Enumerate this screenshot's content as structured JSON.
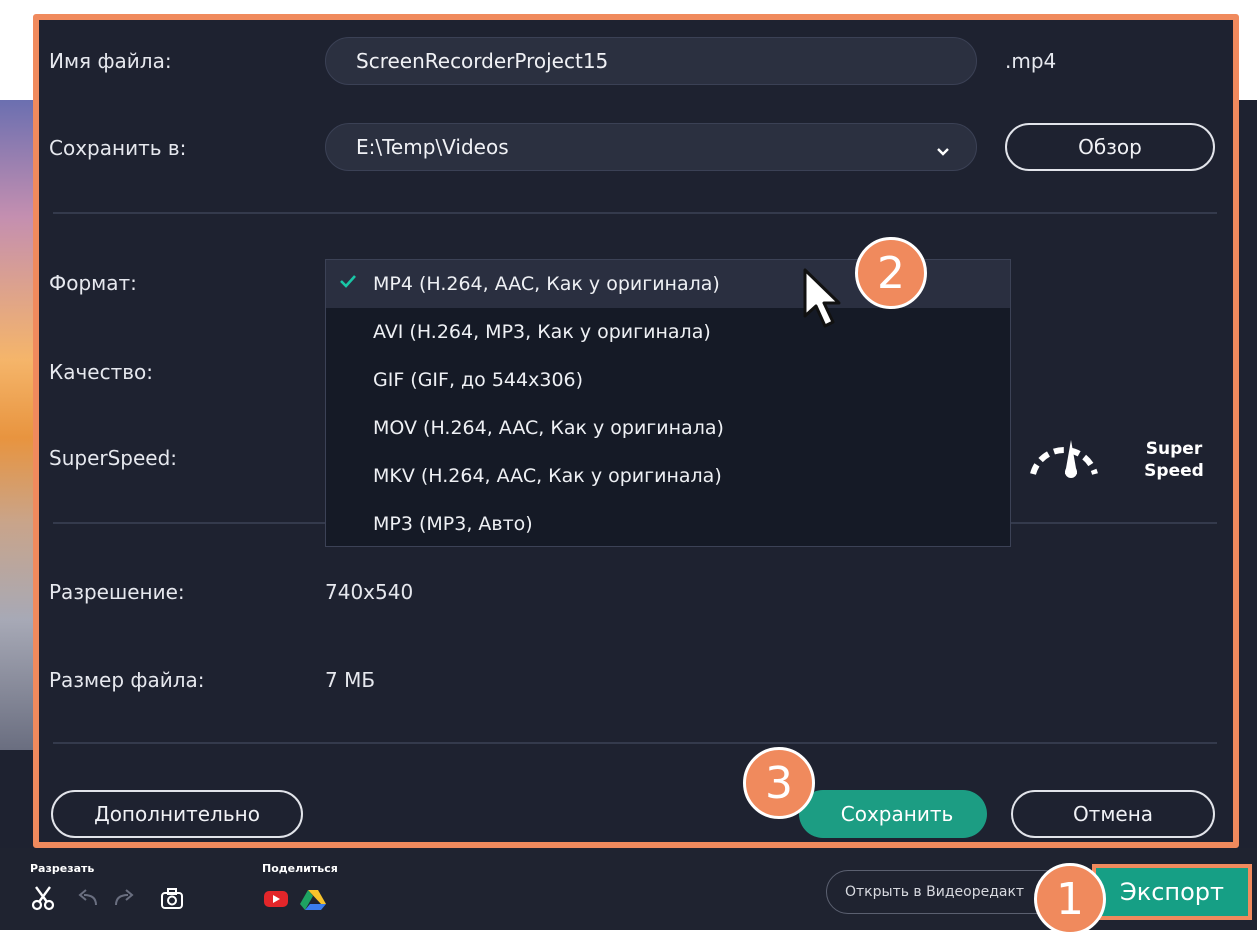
{
  "dialog": {
    "filename": {
      "label": "Имя файла:",
      "value": "ScreenRecorderProject15",
      "extension": ".mp4"
    },
    "save_to": {
      "label": "Сохранить в:",
      "path": "E:\\Temp\\Videos",
      "browse_label": "Обзор"
    },
    "format": {
      "label": "Формат:",
      "options": [
        "MP4 (H.264, AAC, Как у оригинала)",
        "AVI (H.264, MP3, Как у оригинала)",
        "GIF (GIF, до 544x306)",
        "MOV (H.264, AAC, Как у оригинала)",
        "MKV (H.264, AAC, Как у оригинала)",
        "MP3 (MP3, Авто)"
      ],
      "selected_index": 0
    },
    "quality": {
      "label": "Качество:"
    },
    "superspeed": {
      "label": "SuperSpeed:",
      "logo_line1": "Super",
      "logo_line2": "Speed"
    },
    "resolution": {
      "label": "Разрешение:",
      "value": "740x540"
    },
    "file_size": {
      "label": "Размер файла:",
      "value": "7 МБ"
    },
    "advanced_label": "Дополнительно",
    "save_label": "Сохранить",
    "cancel_label": "Отмена"
  },
  "toolbar": {
    "cut_label": "Разрезать",
    "share_label": "Поделиться",
    "open_in_editor_label": "Открыть в Видеоредакт",
    "export_label": "Экспорт"
  },
  "badges": {
    "one": "1",
    "two": "2",
    "three": "3"
  },
  "colors": {
    "accent": "#f08a5d",
    "primary": "#1c9d83",
    "check": "#19c6a6",
    "dialog_bg": "#1e2230"
  },
  "icons": [
    "chevron-down-icon",
    "checkmark-icon",
    "cursor-icon",
    "speedometer-icon",
    "scissors-icon",
    "undo-icon",
    "redo-icon",
    "camera-icon",
    "youtube-icon",
    "google-drive-icon"
  ]
}
